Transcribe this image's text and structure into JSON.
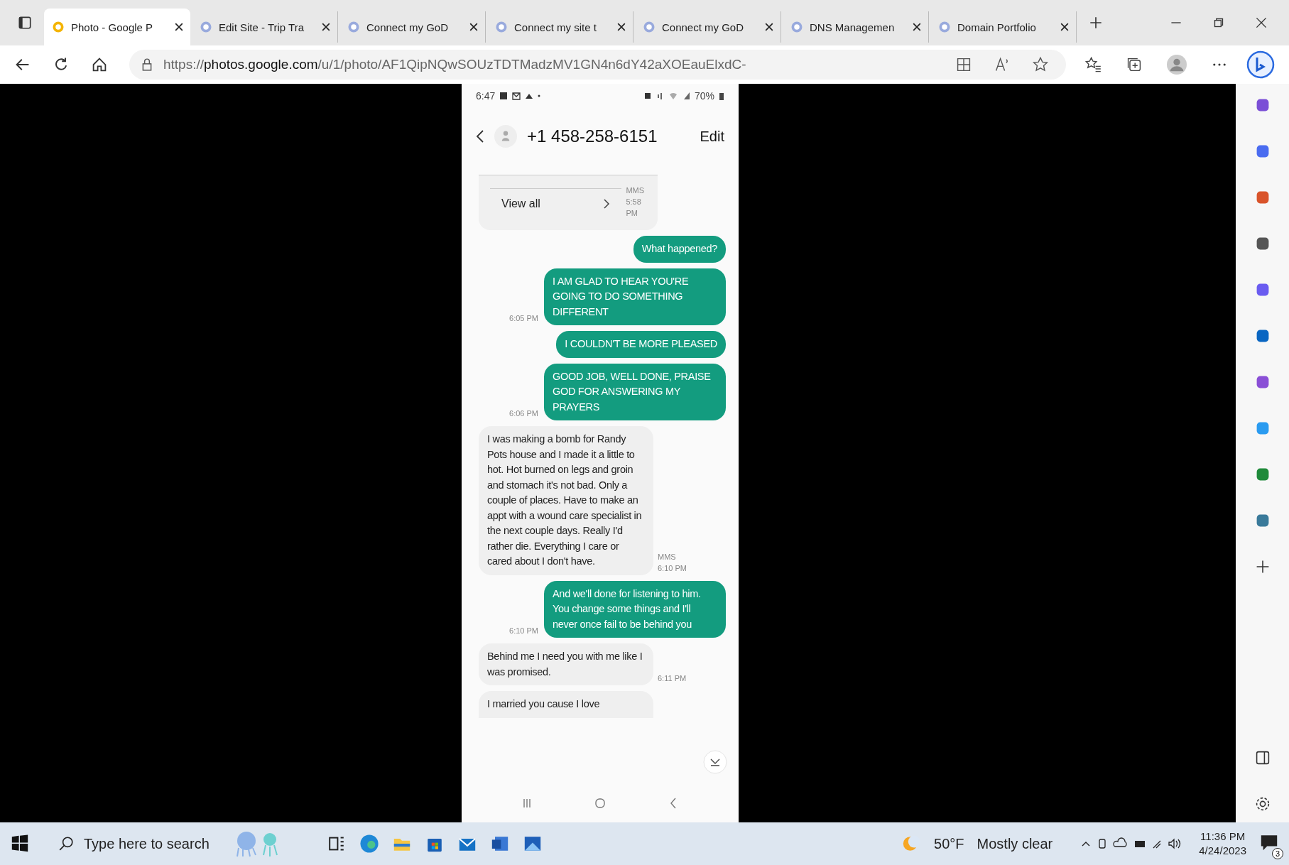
{
  "browser": {
    "tabs": [
      {
        "title": "Photo - Google P",
        "selected": true
      },
      {
        "title": "Edit Site - Trip Tra",
        "selected": false
      },
      {
        "title": "Connect my GoD",
        "selected": false
      },
      {
        "title": "Connect my site t",
        "selected": false
      },
      {
        "title": "Connect my GoD",
        "selected": false
      },
      {
        "title": "DNS Managemen",
        "selected": false
      },
      {
        "title": "Domain Portfolio",
        "selected": false
      }
    ],
    "url": "https://**photos.google.com**/u/1/photo/AF1QipNQwSOUzTDTMadzMV1GN4n6dY42aXOEauElxdC-"
  },
  "phone": {
    "status_time": "6:47",
    "battery": "70%",
    "contact": "+1 458-258-6151",
    "edit": "Edit",
    "messages": [
      {
        "kind": "card",
        "text": "View all",
        "meta": [
          "MMS",
          "5:58 PM"
        ]
      },
      {
        "kind": "sent",
        "text": "What happened?"
      },
      {
        "kind": "sent",
        "text": "I AM GLAD TO HEAR YOU'RE GOING TO DO SOMETHING DIFFERENT",
        "meta": [
          "6:05 PM"
        ]
      },
      {
        "kind": "sent",
        "text": "I COULDN'T BE MORE PLEASED"
      },
      {
        "kind": "sent",
        "text": "GOOD JOB, WELL DONE, PRAISE GOD FOR ANSWERING MY PRAYERS",
        "meta": [
          "6:06 PM"
        ]
      },
      {
        "kind": "received",
        "text": "I was making a bomb for Randy Pots house and I made it a little to hot. Hot burned on legs and groin and stomach it's not bad. Only a couple of places. Have to make an appt with a wound care specialist in the next couple days. Really I'd rather die. Everything I care or cared about I don't have.",
        "meta": [
          "MMS",
          "6:10 PM"
        ]
      },
      {
        "kind": "sent",
        "text": "And we'll done for listening to him. You change some things and I'll never once fail to be behind you",
        "meta": [
          "6:10 PM"
        ]
      },
      {
        "kind": "received",
        "text": "Behind me I need you with me like I was promised.",
        "meta": [
          "6:11 PM"
        ]
      },
      {
        "kind": "received",
        "text": "I married you cause I love"
      }
    ]
  },
  "taskbar": {
    "search_placeholder": "Type here to search",
    "temperature": "50°F",
    "weather": "Mostly clear",
    "time": "11:36 PM",
    "date": "4/24/2023",
    "notifications": "3"
  }
}
